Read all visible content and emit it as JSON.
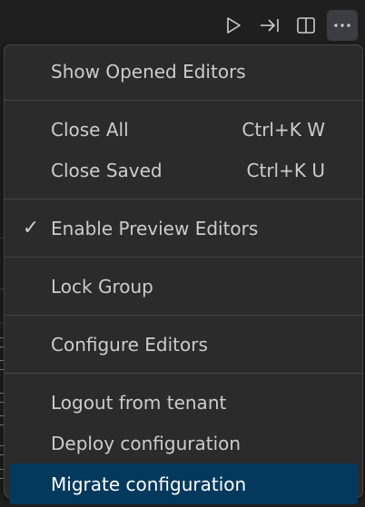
{
  "toolbar": {
    "buttons": [
      {
        "icon": "run-icon",
        "title": "Run"
      },
      {
        "icon": "step-into-icon",
        "title": "Next"
      },
      {
        "icon": "split-editor-icon",
        "title": "Split Editor"
      },
      {
        "icon": "more-actions-icon",
        "title": "More Actions"
      }
    ]
  },
  "menu": {
    "show_opened_editors": "Show Opened Editors",
    "close_all": "Close All",
    "close_all_kb": "Ctrl+K W",
    "close_saved": "Close Saved",
    "close_saved_kb": "Ctrl+K U",
    "enable_preview_check": "✓",
    "enable_preview_editors": "Enable Preview Editors",
    "lock_group": "Lock Group",
    "configure_editors": "Configure Editors",
    "logout_from_tenant": "Logout from tenant",
    "deploy_configuration": "Deploy configuration",
    "migrate_configuration": "Migrate configuration"
  },
  "colors": {
    "menu_background": "#2b2b2b",
    "selected_background": "#04395e",
    "text": "#cccccc"
  }
}
